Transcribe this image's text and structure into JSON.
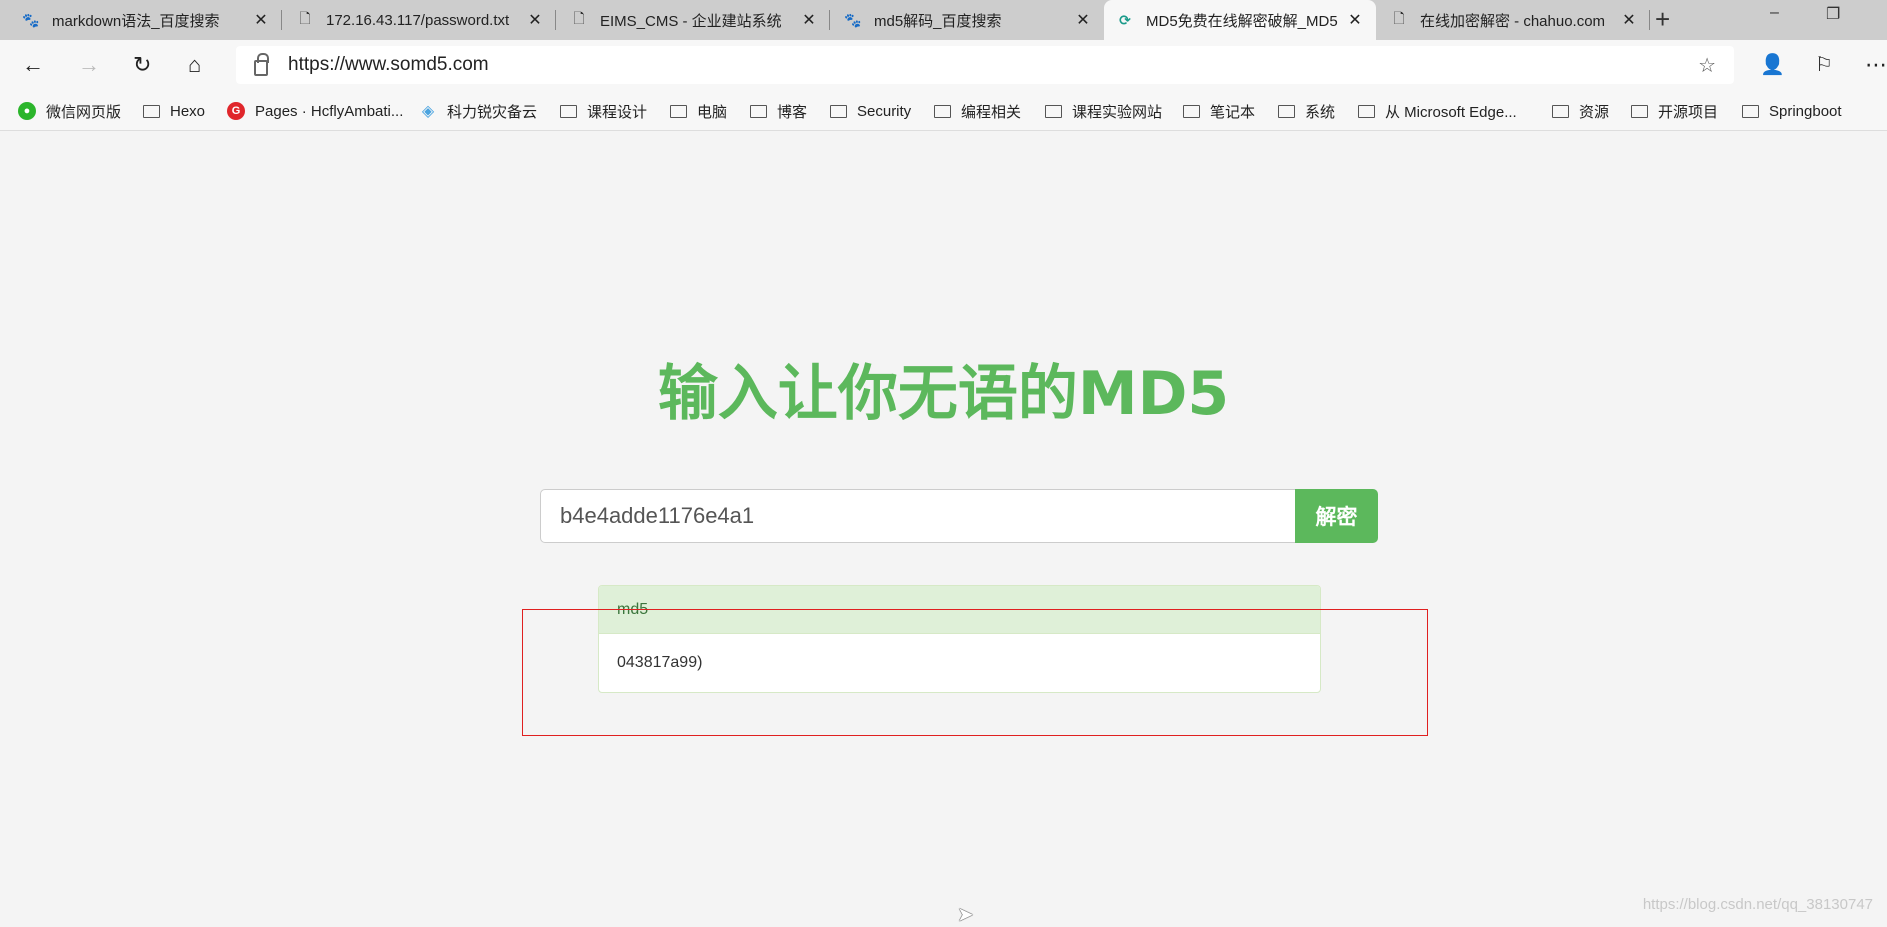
{
  "tabs": [
    {
      "title": "markdown语法_百度搜索",
      "icon": "baidu-paw-icon",
      "active": false
    },
    {
      "title": "172.16.43.117/password.txt",
      "icon": "page-icon",
      "active": false
    },
    {
      "title": "EIMS_CMS - 企业建站系统",
      "icon": "page-icon",
      "active": false
    },
    {
      "title": "md5解码_百度搜索",
      "icon": "baidu-paw-icon",
      "active": false
    },
    {
      "title": "MD5免费在线解密破解_MD5",
      "icon": "somd5-icon",
      "active": true
    },
    {
      "title": "在线加密解密 - chahuo.com",
      "icon": "page-icon",
      "active": false
    }
  ],
  "address": {
    "url": "https://www.somd5.com"
  },
  "bookmarks": [
    "微信网页版",
    "Hexo",
    "Pages · HcflyAmbati...",
    "科力锐灾备云",
    "课程设计",
    "电脑",
    "博客",
    "Security",
    "编程相关",
    "课程实验网站",
    "笔记本",
    "系统",
    "从 Microsoft Edge...",
    "资源",
    "开源项目",
    "Springboot"
  ],
  "page": {
    "title": "输入让你无语的MD5",
    "input_value": "b4e4adde1176e4a1",
    "decrypt_label": "解密",
    "result_header": "md5",
    "result_value": "043817a99)"
  },
  "watermark": "https://blog.csdn.net/qq_38130747",
  "colors": {
    "accent": "#5cb85c",
    "panel_header": "#dff0d8",
    "highlight_box": "#e02020"
  }
}
